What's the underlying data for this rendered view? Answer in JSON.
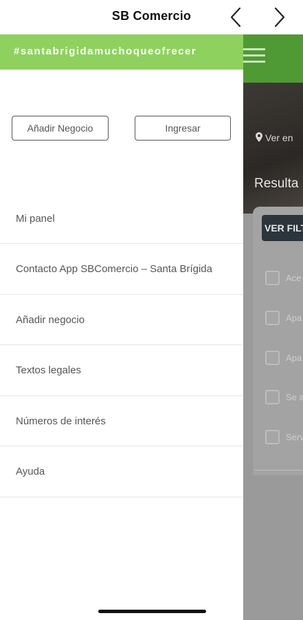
{
  "app": {
    "title": "SB Comercio"
  },
  "nav": {
    "back_icon": "chevron-left-icon",
    "forward_icon": "chevron-right-icon"
  },
  "drawer": {
    "hashtag": "#santabrigidamuchoqueofrecer",
    "add_business_button": "Añadir Negocio",
    "login_button": "Ingresar",
    "items": [
      {
        "label": "Mi panel"
      },
      {
        "label": "Contacto App SBComercio – Santa Brígida"
      },
      {
        "label": "Añadir negocio"
      },
      {
        "label": "Textos legales"
      },
      {
        "label": "Números de interés"
      },
      {
        "label": "Ayuda"
      }
    ]
  },
  "background_page": {
    "location_text": "Ver en",
    "results_text": "Resulta",
    "filter_button": "VER FILT",
    "checkbox_labels": [
      "Ace",
      "Apa",
      "Apa",
      "Se a",
      "Serv"
    ]
  },
  "colors": {
    "drawer_banner": "#8fd15e",
    "page_header": "#4f9a34",
    "filter_button_bg": "#2c343c"
  }
}
